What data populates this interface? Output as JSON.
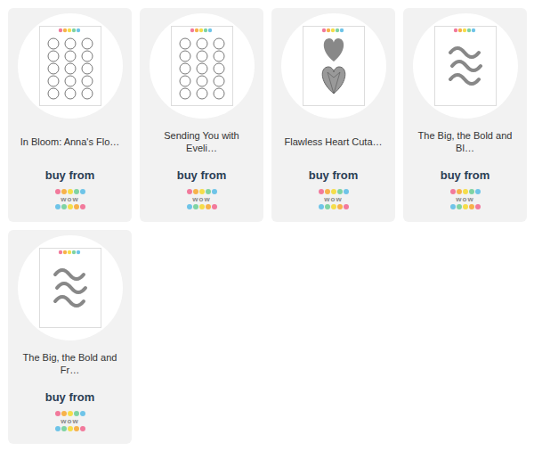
{
  "products": [
    {
      "title": "In Bloom: Anna's Flo…",
      "button": "buy from",
      "logo": "wow",
      "kind": "stamp"
    },
    {
      "title": "Sending You with Eveli…",
      "button": "buy from",
      "logo": "wow",
      "kind": "stamp"
    },
    {
      "title": "Flawless Heart Cuta…",
      "button": "buy from",
      "logo": "wow",
      "kind": "heart"
    },
    {
      "title": "The Big, the Bold and Bl…",
      "button": "buy from",
      "logo": "wow",
      "kind": "die"
    },
    {
      "title": "The Big, the Bold and Fr…",
      "button": "buy from",
      "logo": "wow",
      "kind": "die"
    }
  ]
}
